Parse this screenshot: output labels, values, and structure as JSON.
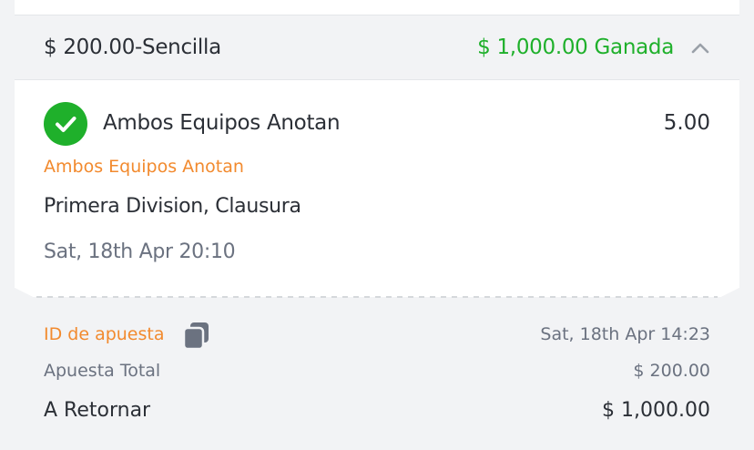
{
  "bet": {
    "stake_type": "$ 200.00-Sencilla",
    "result": "$ 1,000.00 Ganada",
    "expanded_icon": "chevron-up-icon"
  },
  "selection": {
    "status_icon": "check-circle-icon",
    "name": "Ambos Equipos Anotan",
    "odds": "5.00",
    "market": "Ambos Equipos Anotan",
    "league": "Primera Division, Clausura",
    "event_time": "Sat, 18th Apr 20:10"
  },
  "details": {
    "bet_id_label": "ID de apuesta",
    "copy_icon": "copy-icon",
    "placed_time": "Sat, 18th Apr 14:23",
    "total_label": "Apuesta Total",
    "total_value": "$ 200.00",
    "return_label": "A Retornar",
    "return_value": "$ 1,000.00"
  },
  "colors": {
    "win_green": "#1fb02b",
    "accent_orange": "#f28a2e",
    "text_dark": "#2b2f36",
    "text_muted": "#6b7280",
    "panel_gray": "#f2f3f5"
  }
}
